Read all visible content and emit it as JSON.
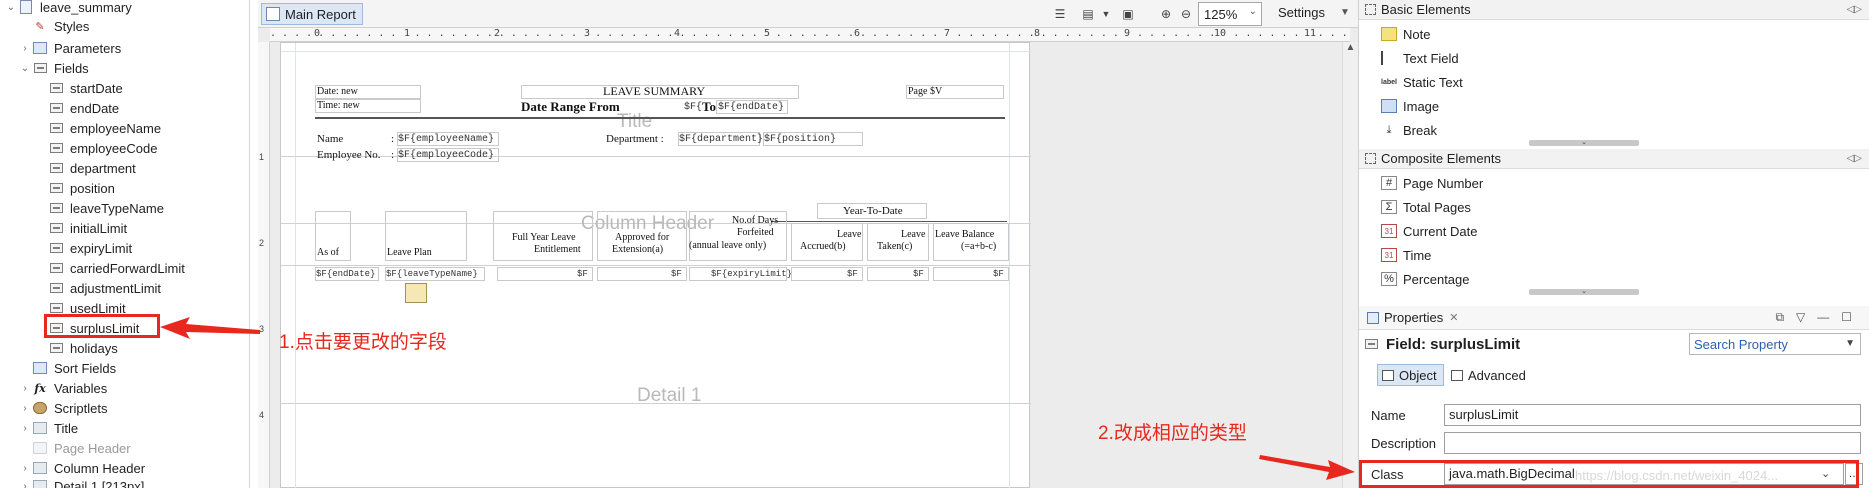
{
  "outline": {
    "report_name": "leave_summary",
    "nodes": {
      "styles": "Styles",
      "parameters": "Parameters",
      "fields": "Fields",
      "sort_fields": "Sort Fields",
      "variables": "Variables",
      "scriptlets": "Scriptlets",
      "title": "Title",
      "page_header": "Page Header",
      "column_header": "Column Header",
      "detail": "Detail 1 [213px]"
    },
    "field_items": [
      "startDate",
      "endDate",
      "employeeName",
      "employeeCode",
      "department",
      "position",
      "leaveTypeName",
      "initialLimit",
      "expiryLimit",
      "carriedForwardLimit",
      "adjustmentLimit",
      "usedLimit",
      "surplusLimit",
      "holidays"
    ],
    "selected_field": "surplusLimit"
  },
  "editor": {
    "tab": "Main Report",
    "zoom": "125%",
    "settings": "Settings",
    "ruler_numbers": [
      "0",
      "1",
      "2",
      "3",
      "4",
      "5",
      "6",
      "7",
      "8",
      "9",
      "10",
      "11"
    ],
    "report": {
      "date_label": "Date: new",
      "time_label": "Time: new",
      "title": "LEAVE SUMMARY",
      "date_range_from": "Date Range From",
      "title_band": "Title",
      "start_field": "$F{",
      "to_label": "To",
      "end_field": "$F{endDate}",
      "page_label": "Page $V",
      "name_label": "Name",
      "name_colon": ":",
      "employee_name": "$F{employeeName}",
      "employee_no_label": "Employee No.",
      "employee_no_colon": ":",
      "employee_code": "$F{employeeCode}",
      "department_label": "Department :",
      "department_field": "$F{department}",
      "position_field": "$F{position}",
      "year_to_date": "Year-To-Date",
      "column_header_band": "Column Header",
      "col_as_of": "As of",
      "col_leave_plan": "Leave Plan",
      "col_full_year_1": "Full Year Leave",
      "col_full_year_2": "Entitlement",
      "col_approved_1": "Approved for",
      "col_approved_2": "Extension(a)",
      "col_forfeited_1": "No.of Days",
      "col_forfeited_2": "Forfeited",
      "col_forfeited_3": "(annual leave only)",
      "col_accrued_1": "Leave",
      "col_accrued_2": "Accrued(b)",
      "col_taken_1": "Leave",
      "col_taken_2": "Taken(c)",
      "col_balance_1": "Leave Balance",
      "col_balance_2": "(=a+b-c)",
      "det_end_date": "$F{endDate}",
      "det_leave_type": "$F{leaveTypeName}",
      "det_f1": "$F",
      "det_f2": "$F",
      "det_expiry": "$F{expiryLimit}",
      "det_f3": "$F",
      "det_f4": "$F",
      "det_f5": "$F",
      "detail_band": "Detail 1"
    }
  },
  "palette": {
    "basic_title": "Basic Elements",
    "basic": [
      "Note",
      "Text Field",
      "Static Text",
      "Image",
      "Break"
    ],
    "composite_title": "Composite Elements",
    "composite": [
      "Page Number",
      "Total Pages",
      "Current Date",
      "Time",
      "Percentage"
    ],
    "static_text_icon": "label"
  },
  "properties": {
    "tab": "Properties",
    "header": "Field: surplusLimit",
    "search_placeholder": "Search Property",
    "tab_object": "Object",
    "tab_advanced": "Advanced",
    "name_label": "Name",
    "name_value": "surplusLimit",
    "description_label": "Description",
    "description_value": "",
    "class_label": "Class",
    "class_value": "java.math.BigDecimal",
    "watermark": "https://blog.csdn.net/weixin_4024..."
  },
  "annotations": {
    "step1": "1.点击要更改的字段",
    "step2": "2.改成相应的类型",
    "color": "#e8281e"
  }
}
